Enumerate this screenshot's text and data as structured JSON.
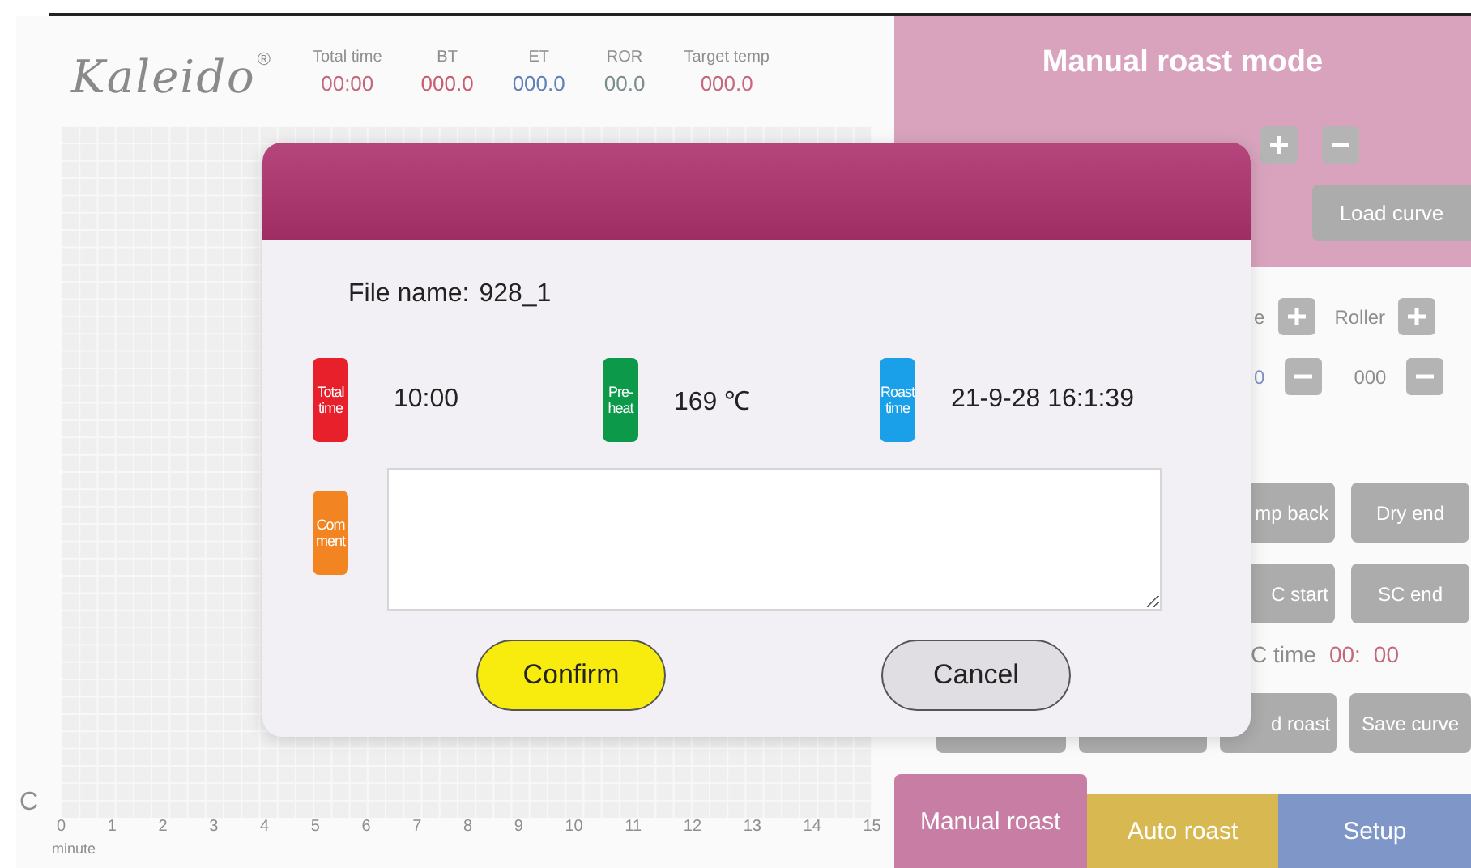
{
  "screen": {
    "logo": {
      "name": "Kaleido",
      "mark": "®"
    },
    "readouts": [
      {
        "label": "Total time",
        "value": "00:00",
        "color": "#c4687e"
      },
      {
        "label": "BT",
        "value": "000.0",
        "color": "#c85c70"
      },
      {
        "label": "ET",
        "value": "000.0",
        "color": "#5f80b8"
      },
      {
        "label": "ROR",
        "value": "00.0",
        "color": "#7a8c8c"
      },
      {
        "label": "Target temp",
        "value": "000.0",
        "color": "#c4687e"
      }
    ],
    "chart": {
      "x_ticks": [
        "0",
        "1",
        "2",
        "3",
        "4",
        "5",
        "6",
        "7",
        "8",
        "9",
        "10",
        "11",
        "12",
        "13",
        "14",
        "15"
      ],
      "x_label": "minute",
      "y_unit": "C"
    },
    "panel": {
      "title": "Manual roast mode",
      "load_button": "Load curve",
      "controls": [
        {
          "label": "e",
          "value": "0"
        },
        {
          "label": "Roller",
          "value": "000"
        }
      ],
      "buttons": [
        "mp back",
        "Dry end",
        "C start",
        "SC end"
      ],
      "fc_time": {
        "label": "C time",
        "minutes": "00:",
        "seconds": "00"
      },
      "bottom_buttons": [
        "d roast",
        "Save curve"
      ]
    },
    "tabs": [
      {
        "label": "Manual roast",
        "selected": true,
        "color": "#c87ea4"
      },
      {
        "label": "Auto roast",
        "selected": false,
        "color": "#d8b850"
      },
      {
        "label": "Setup",
        "selected": false,
        "color": "#7f96c8"
      }
    ]
  },
  "dialog": {
    "file_label": "File name:",
    "file_name": "928_1",
    "fields": [
      {
        "badge": "Total time",
        "value": "10:00",
        "color": "#e8202c"
      },
      {
        "badge": "Pre-heat",
        "value": "169 ℃",
        "color": "#0c9a4a"
      },
      {
        "badge": "Roast time",
        "value": "21-9-28 16:1:39",
        "color": "#1aa0e8"
      }
    ],
    "comment": {
      "badge": "Com\nment",
      "color": "#f28422"
    },
    "buttons": [
      {
        "label": "Confirm",
        "kind": "primary"
      },
      {
        "label": "Cancel",
        "kind": "secondary"
      }
    ]
  }
}
